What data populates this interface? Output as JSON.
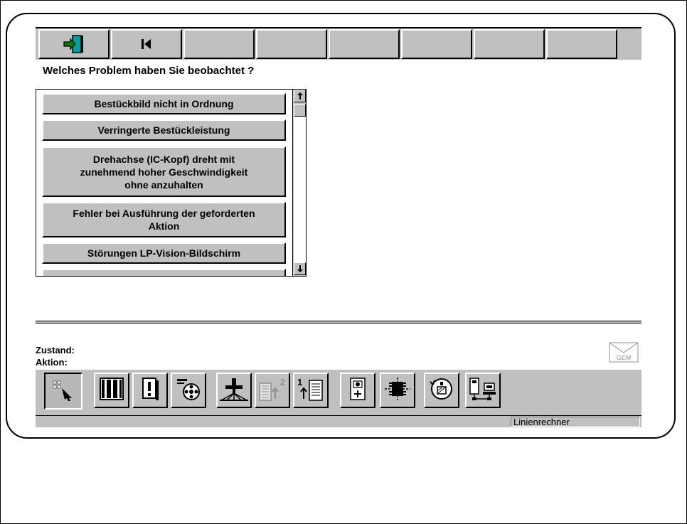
{
  "question": "Welches Problem haben Sie beobachtet ?",
  "toolbar": {
    "buttons": [
      {
        "icon": "exit-door-icon"
      },
      {
        "icon": "skip-to-start-icon"
      },
      {
        "icon": ""
      },
      {
        "icon": ""
      },
      {
        "icon": ""
      },
      {
        "icon": ""
      },
      {
        "icon": ""
      },
      {
        "icon": ""
      }
    ]
  },
  "problems": [
    "Bestückbild nicht in Ordnung",
    "Verringerte Bestückleistung",
    "Drehachse (IC-Kopf) dreht mit\nzunehmend hoher Geschwindigkeit\nohne anzuhalten",
    "Fehler bei Ausführung der geforderten\nAktion",
    "Störungen LP-Vision-Bildschirm"
  ],
  "status": {
    "zustand_label": "Zustand:",
    "aktion_label": "Aktion:"
  },
  "mail_badge": "GEM",
  "system_name": "Linienrechner",
  "colors": {
    "panel": "#c0c0c0",
    "exit_icon": "#00a0a0",
    "exit_arrow": "#008000"
  }
}
